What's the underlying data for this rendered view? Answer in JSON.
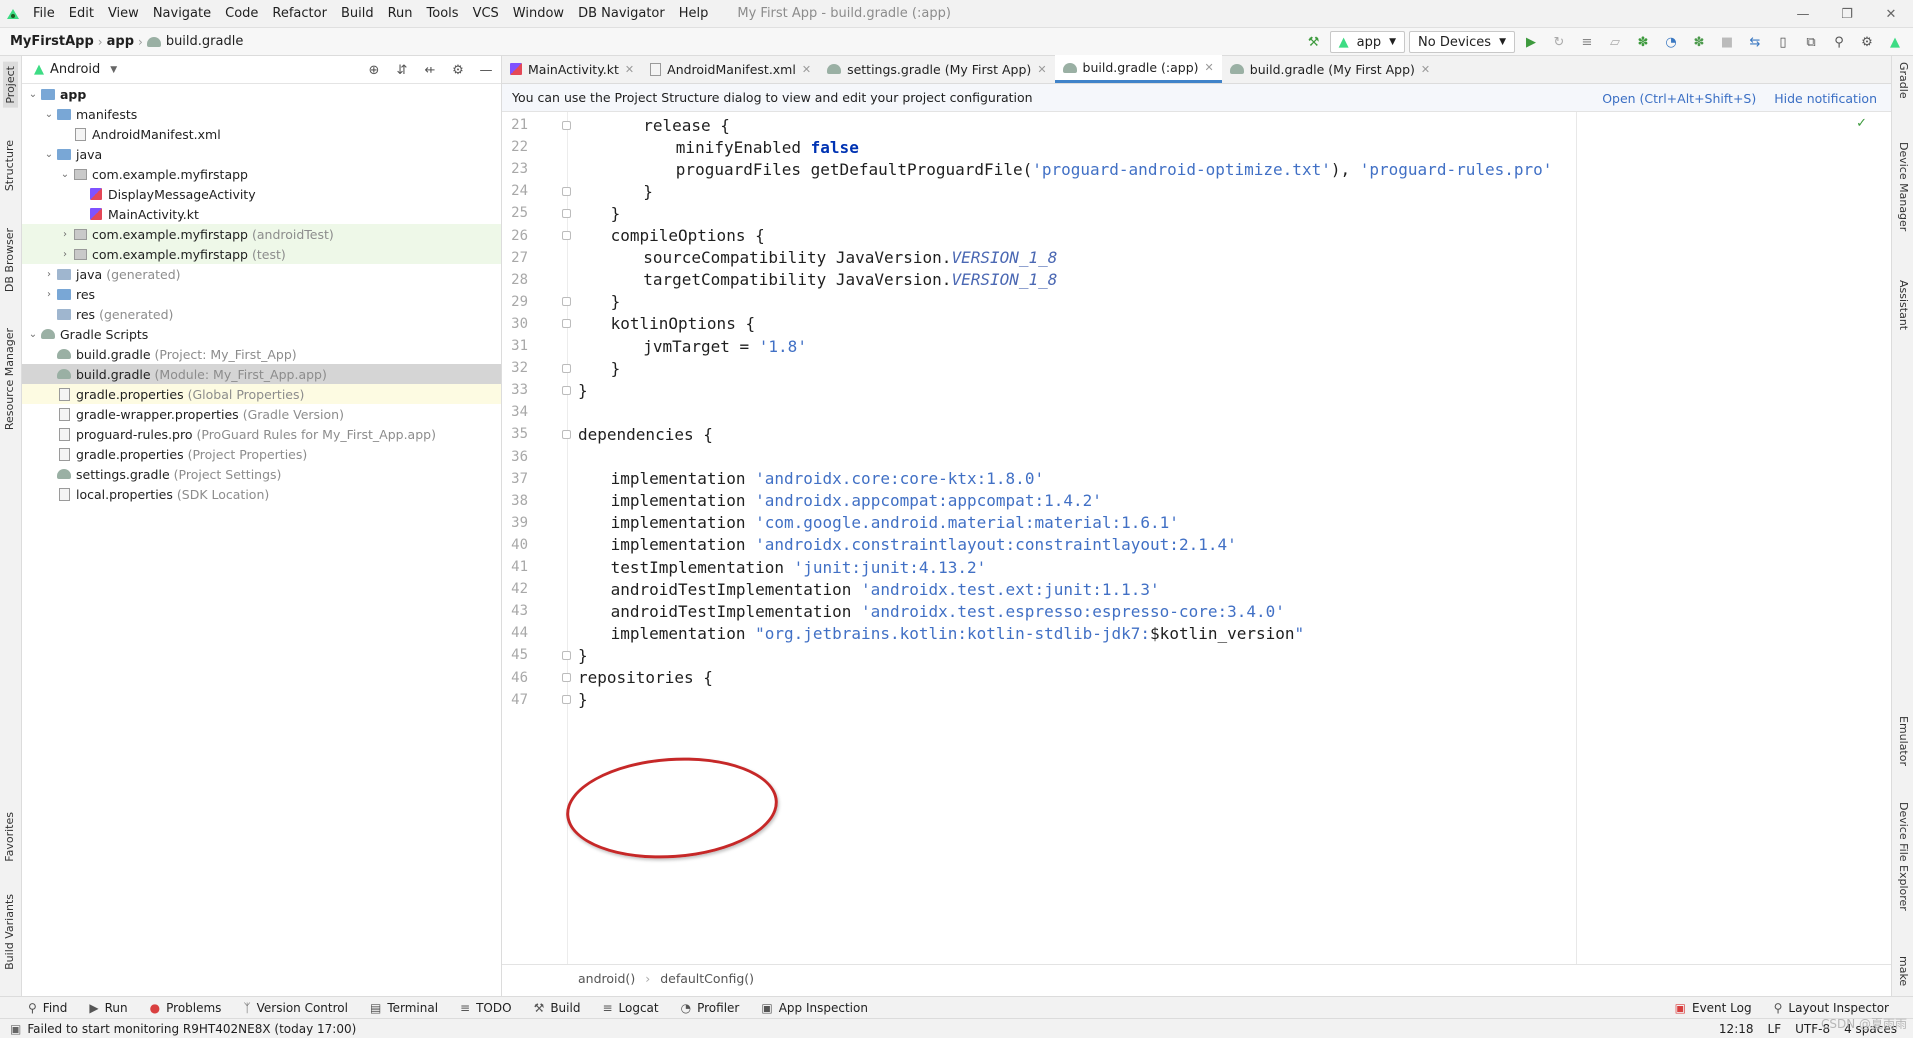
{
  "menubar": {
    "items": [
      "File",
      "Edit",
      "View",
      "Navigate",
      "Code",
      "Refactor",
      "Build",
      "Run",
      "Tools",
      "VCS",
      "Window",
      "DB Navigator",
      "Help"
    ],
    "window_title": "My First App - build.gradle (:app)"
  },
  "navbar": {
    "project": "MyFirstApp",
    "module": "app",
    "file": "build.gradle",
    "run_config": "app",
    "device": "No Devices"
  },
  "left_strip": {
    "tabs": [
      "Project",
      "Structure",
      "DB Browser",
      "Resource Manager",
      "Favorites",
      "Build Variants"
    ]
  },
  "right_strip": {
    "tabs": [
      "Gradle",
      "Device Manager",
      "Assistant",
      "Emulator",
      "Device File Explorer",
      "make"
    ]
  },
  "project_panel": {
    "view_mode": "Android",
    "tree": [
      {
        "label": "app",
        "hint": "",
        "depth": 0,
        "icon": "folder-icon",
        "bold": true,
        "expanded": true
      },
      {
        "label": "manifests",
        "hint": "",
        "depth": 1,
        "icon": "folder-icon",
        "expanded": true
      },
      {
        "label": "AndroidManifest.xml",
        "hint": "",
        "depth": 2,
        "icon": "xml-file-icon"
      },
      {
        "label": "java",
        "hint": "",
        "depth": 1,
        "icon": "folder-icon",
        "expanded": true
      },
      {
        "label": "com.example.myfirstapp",
        "hint": "",
        "depth": 2,
        "icon": "package-icon",
        "expanded": true
      },
      {
        "label": "DisplayMessageActivity",
        "hint": "",
        "depth": 3,
        "icon": "kotlin-file-icon"
      },
      {
        "label": "MainActivity.kt",
        "hint": "",
        "depth": 3,
        "icon": "kotlin-file-icon"
      },
      {
        "label": "com.example.myfirstapp",
        "hint": "(androidTest)",
        "depth": 2,
        "icon": "package-icon",
        "collapsed": true,
        "tint": "test"
      },
      {
        "label": "com.example.myfirstapp",
        "hint": "(test)",
        "depth": 2,
        "icon": "package-icon",
        "collapsed": true,
        "tint": "test"
      },
      {
        "label": "java",
        "hint": "(generated)",
        "depth": 1,
        "icon": "folder-icon",
        "collapsed": true
      },
      {
        "label": "res",
        "hint": "",
        "depth": 1,
        "icon": "folder-icon",
        "collapsed": true
      },
      {
        "label": "res",
        "hint": "(generated)",
        "depth": 1,
        "icon": "folder-icon"
      },
      {
        "label": "Gradle Scripts",
        "hint": "",
        "depth": 0,
        "icon": "gradle-icon",
        "expanded": true
      },
      {
        "label": "build.gradle",
        "hint": "(Project: My_First_App)",
        "depth": 1,
        "icon": "gradle-icon"
      },
      {
        "label": "build.gradle",
        "hint": "(Module: My_First_App.app)",
        "depth": 1,
        "icon": "gradle-icon",
        "selected": true
      },
      {
        "label": "gradle.properties",
        "hint": "(Global Properties)",
        "depth": 1,
        "icon": "properties-file-icon",
        "tint": "yellow"
      },
      {
        "label": "gradle-wrapper.properties",
        "hint": "(Gradle Version)",
        "depth": 1,
        "icon": "properties-file-icon"
      },
      {
        "label": "proguard-rules.pro",
        "hint": "(ProGuard Rules for My_First_App.app)",
        "depth": 1,
        "icon": "file-icon"
      },
      {
        "label": "gradle.properties",
        "hint": "(Project Properties)",
        "depth": 1,
        "icon": "properties-file-icon"
      },
      {
        "label": "settings.gradle",
        "hint": "(Project Settings)",
        "depth": 1,
        "icon": "gradle-icon"
      },
      {
        "label": "local.properties",
        "hint": "(SDK Location)",
        "depth": 1,
        "icon": "properties-file-icon"
      }
    ]
  },
  "editor": {
    "tabs": [
      {
        "label": "MainActivity.kt",
        "active": false
      },
      {
        "label": "AndroidManifest.xml",
        "active": false
      },
      {
        "label": "settings.gradle (My First App)",
        "active": false
      },
      {
        "label": "build.gradle (:app)",
        "active": true
      },
      {
        "label": "build.gradle (My First App)",
        "active": false
      }
    ],
    "notification": "You can use the Project Structure dialog to view and edit your project configuration",
    "notification_open": "Open (Ctrl+Alt+Shift+S)",
    "notification_hide": "Hide notification",
    "code": [
      {
        "n": "21",
        "indent": 2,
        "parts": [
          {
            "t": "release {",
            "c": ""
          }
        ],
        "fold": true
      },
      {
        "n": "22",
        "indent": 3,
        "parts": [
          {
            "t": "minifyEnabled ",
            "c": ""
          },
          {
            "t": "false",
            "c": "kw"
          }
        ]
      },
      {
        "n": "23",
        "indent": 3,
        "parts": [
          {
            "t": "proguardFiles getDefaultProguardFile(",
            "c": ""
          },
          {
            "t": "'proguard-android-optimize.txt'",
            "c": "str"
          },
          {
            "t": "), ",
            "c": ""
          },
          {
            "t": "'proguard-rules.pro'",
            "c": "str"
          }
        ]
      },
      {
        "n": "24",
        "indent": 2,
        "parts": [
          {
            "t": "}",
            "c": ""
          }
        ],
        "fold": true
      },
      {
        "n": "25",
        "indent": 1,
        "parts": [
          {
            "t": "}",
            "c": ""
          }
        ],
        "fold": true
      },
      {
        "n": "26",
        "indent": 1,
        "parts": [
          {
            "t": "compileOptions {",
            "c": ""
          }
        ],
        "fold": true
      },
      {
        "n": "27",
        "indent": 2,
        "parts": [
          {
            "t": "sourceCompatibility JavaVersion.",
            "c": ""
          },
          {
            "t": "VERSION_1_8",
            "c": "it"
          }
        ]
      },
      {
        "n": "28",
        "indent": 2,
        "parts": [
          {
            "t": "targetCompatibility JavaVersion.",
            "c": ""
          },
          {
            "t": "VERSION_1_8",
            "c": "it"
          }
        ]
      },
      {
        "n": "29",
        "indent": 1,
        "parts": [
          {
            "t": "}",
            "c": ""
          }
        ],
        "fold": true
      },
      {
        "n": "30",
        "indent": 1,
        "parts": [
          {
            "t": "kotlinOptions {",
            "c": ""
          }
        ],
        "fold": true
      },
      {
        "n": "31",
        "indent": 2,
        "parts": [
          {
            "t": "jvmTarget = ",
            "c": ""
          },
          {
            "t": "'1.8'",
            "c": "str"
          }
        ]
      },
      {
        "n": "32",
        "indent": 1,
        "parts": [
          {
            "t": "}",
            "c": ""
          }
        ],
        "fold": true
      },
      {
        "n": "33",
        "indent": 0,
        "parts": [
          {
            "t": "}",
            "c": ""
          }
        ],
        "fold": true
      },
      {
        "n": "34",
        "indent": 0,
        "parts": []
      },
      {
        "n": "35",
        "indent": 0,
        "parts": [
          {
            "t": "dependencies {",
            "c": ""
          }
        ],
        "fold": true
      },
      {
        "n": "36",
        "indent": 0,
        "parts": []
      },
      {
        "n": "37",
        "indent": 1,
        "parts": [
          {
            "t": "implementation ",
            "c": ""
          },
          {
            "t": "'androidx.core:core-ktx:1.8.0'",
            "c": "str"
          }
        ]
      },
      {
        "n": "38",
        "indent": 1,
        "parts": [
          {
            "t": "implementation ",
            "c": ""
          },
          {
            "t": "'androidx.appcompat:appcompat:1.4.2'",
            "c": "str"
          }
        ]
      },
      {
        "n": "39",
        "indent": 1,
        "parts": [
          {
            "t": "implementation ",
            "c": ""
          },
          {
            "t": "'com.google.android.material:material:1.6.1'",
            "c": "str"
          }
        ]
      },
      {
        "n": "40",
        "indent": 1,
        "parts": [
          {
            "t": "implementation ",
            "c": ""
          },
          {
            "t": "'androidx.constraintlayout:constraintlayout:2.1.4'",
            "c": "str"
          }
        ]
      },
      {
        "n": "41",
        "indent": 1,
        "parts": [
          {
            "t": "testImplementation ",
            "c": ""
          },
          {
            "t": "'junit:junit:4.13.2'",
            "c": "str"
          }
        ]
      },
      {
        "n": "42",
        "indent": 1,
        "parts": [
          {
            "t": "androidTestImplementation ",
            "c": ""
          },
          {
            "t": "'androidx.test.ext:junit:1.1.3'",
            "c": "str"
          }
        ]
      },
      {
        "n": "43",
        "indent": 1,
        "parts": [
          {
            "t": "androidTestImplementation ",
            "c": ""
          },
          {
            "t": "'androidx.test.espresso:espresso-core:3.4.0'",
            "c": "str"
          }
        ]
      },
      {
        "n": "44",
        "indent": 1,
        "parts": [
          {
            "t": "implementation ",
            "c": ""
          },
          {
            "t": "\"org.jetbrains.kotlin:kotlin-stdlib-jdk7:",
            "c": "str"
          },
          {
            "t": "$kotlin_version",
            "c": ""
          },
          {
            "t": "\"",
            "c": "str"
          }
        ]
      },
      {
        "n": "45",
        "indent": 0,
        "parts": [
          {
            "t": "}",
            "c": ""
          }
        ],
        "fold": true
      },
      {
        "n": "46",
        "indent": 0,
        "parts": [
          {
            "t": "repositories {",
            "c": ""
          }
        ],
        "fold": true
      },
      {
        "n": "47",
        "indent": 0,
        "parts": [
          {
            "t": "}",
            "c": ""
          }
        ],
        "fold": true
      }
    ],
    "breadcrumb": [
      "android()",
      "defaultConfig()"
    ]
  },
  "bottom_toolbar": {
    "left": [
      "Find",
      "Run",
      "Problems",
      "Version Control",
      "Terminal",
      "TODO",
      "Build",
      "Logcat",
      "Profiler",
      "App Inspection"
    ],
    "right": [
      "Event Log",
      "Layout Inspector"
    ]
  },
  "statusbar": {
    "message": "Failed to start monitoring R9HT402NE8X (today 17:00)",
    "position": "12:18",
    "line_sep": "LF",
    "encoding": "UTF-8",
    "indent": "4 spaces",
    "watermark": "CSDN @夏雨雨"
  },
  "colors": {
    "keyword": "#0033b3",
    "string": "#4170c5",
    "annotation": "#c62828",
    "accent": "#4083c9"
  }
}
